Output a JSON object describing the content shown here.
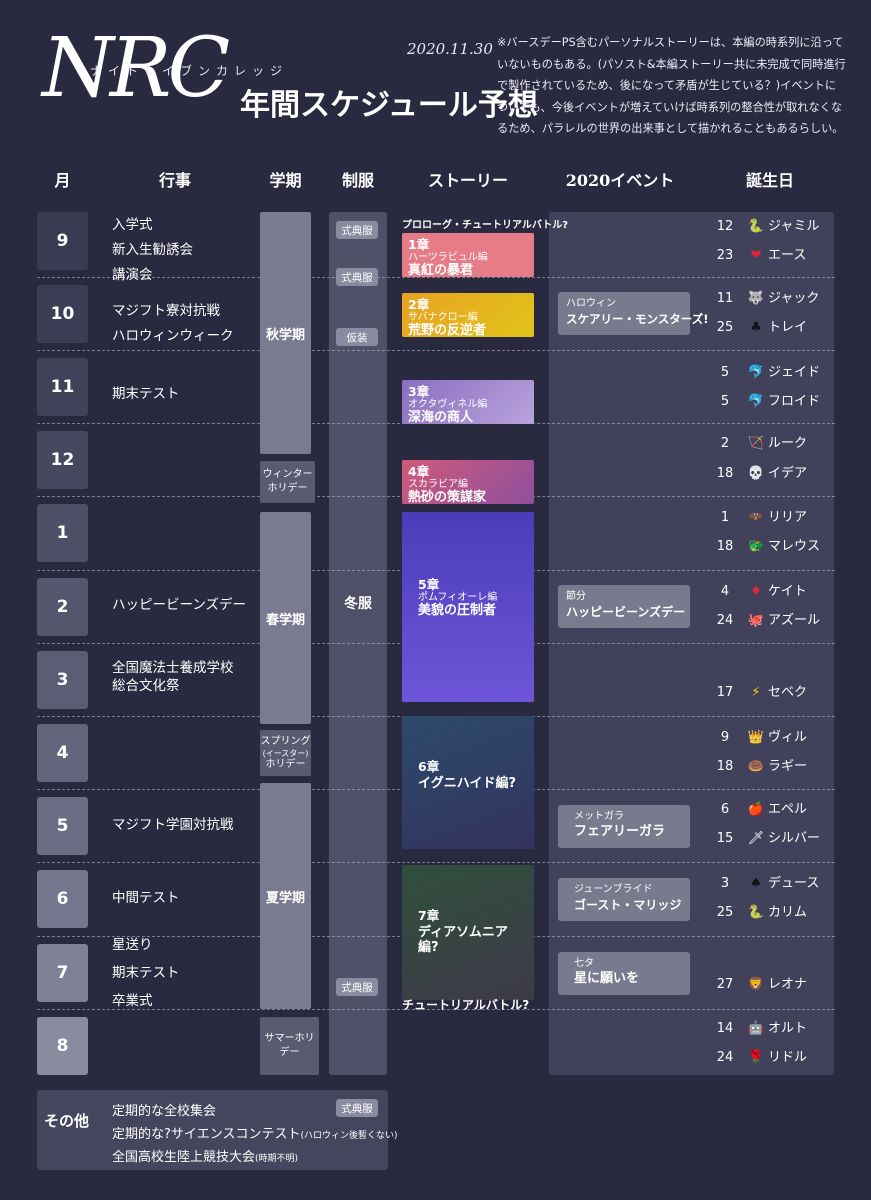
{
  "header": {
    "logo": "NRC",
    "logo_ruby": "ナイトレイブンカレッジ",
    "date": "2020.11.30",
    "title": "年間スケジュール予想",
    "note": "※バースデーPS含むパーソナルストーリーは、本編の時系列に沿っていないものもある。(パソスト&本編ストーリー共に未完成で同時進行で製作されているため、後になって矛盾が生じている？)イベントについても、今後イベントが増えていけば時系列の整合性が取れなくなるため、パラレルの世界の出来事として描かれることもあるらしい。"
  },
  "columns": {
    "month": "月",
    "events": "行事",
    "term": "学期",
    "uniform": "制服",
    "story": "ストーリー",
    "event2020": "2020イベント",
    "birthday": "誕生日"
  },
  "months": [
    "9",
    "10",
    "11",
    "12",
    "1",
    "2",
    "3",
    "4",
    "5",
    "6",
    "7",
    "8"
  ],
  "school_events": {
    "m9_1": "入学式",
    "m9_2": "新入生勧誘会",
    "m9_3": "講演会",
    "m10_1": "マジフト寮対抗戦",
    "m10_2": "ハロウィンウィーク",
    "m11_1": "期末テスト",
    "m2_1": "ハッピービーンズデー",
    "m3_1": "全国魔法士養成学校",
    "m3_2": "総合文化祭",
    "m5_1": "マジフト学園対抗戦",
    "m6_1": "中間テスト",
    "m7_1": "星送り",
    "m7_2": "期末テスト",
    "m7_3": "卒業式"
  },
  "terms": {
    "autumn": "秋学期",
    "winter": "ウィンターホリデー",
    "spring_term": "春学期",
    "spring_holiday_1": "スプリング",
    "spring_holiday_2": "(イースター)",
    "spring_holiday_3": "ホリデー",
    "summer_term": "夏学期",
    "summer_holiday": "サマーホリデー"
  },
  "uniform": {
    "ceremony": "式典服",
    "costume": "仮装",
    "winter": "冬服"
  },
  "story": {
    "prologue": "プロローグ・チュートリアルバトル?",
    "ch1": {
      "num": "1章",
      "arc": "ハーツラビュル編",
      "sub": "真紅の暴君",
      "color": "#e57c87"
    },
    "ch2": {
      "num": "2章",
      "arc": "サバナクロー編",
      "sub": "荒野の反逆者",
      "color": "#e6b31a"
    },
    "ch3": {
      "num": "3章",
      "arc": "オクタヴィネル編",
      "sub": "深海の商人",
      "color": "#a58fcf"
    },
    "ch4": {
      "num": "4章",
      "arc": "スカラビア編",
      "sub": "熱砂の策謀家",
      "color": "#b0588e"
    },
    "ch5": {
      "num": "5章",
      "arc": "ポムフィオーレ編",
      "sub": "美貌の圧制者",
      "color": "#5a48c9"
    },
    "ch6": {
      "num": "6章",
      "arc": "",
      "sub": "イグニハイド編?",
      "color": "#2d3e6e"
    },
    "ch7": {
      "num": "7章",
      "arc": "",
      "sub": "ディアソムニア編?",
      "color": "#3a4a3e"
    },
    "tutorial": "チュートリアルバトル?"
  },
  "events2020": {
    "halloween": {
      "l1": "ハロウィン",
      "l2": "スケアリー・モンスターズ!"
    },
    "setsubun": {
      "l1": "節分",
      "l2": "ハッピービーンズデー"
    },
    "metgala": {
      "l1": "メットガラ",
      "l2": "フェアリーガラ"
    },
    "june": {
      "l1": "ジューンブライド",
      "l2": "ゴースト・マリッジ"
    },
    "tanabata": {
      "l1": "七タ",
      "l2": "星に願いを"
    }
  },
  "birthdays": [
    {
      "day": "12",
      "icon": "🐍",
      "name": "ジャミル"
    },
    {
      "day": "23",
      "icon": "❤",
      "name": "エース"
    },
    {
      "day": "11",
      "icon": "🐺",
      "name": "ジャック"
    },
    {
      "day": "25",
      "icon": "♣",
      "name": "トレイ"
    },
    {
      "day": "5",
      "icon": "🐬",
      "name": "ジェイド"
    },
    {
      "day": "5",
      "icon": "🐬",
      "name": "フロイド"
    },
    {
      "day": "2",
      "icon": "🏹",
      "name": "ルーク"
    },
    {
      "day": "18",
      "icon": "💀",
      "name": "イデア"
    },
    {
      "day": "1",
      "icon": "🦇",
      "name": "リリア"
    },
    {
      "day": "18",
      "icon": "🐲",
      "name": "マレウス"
    },
    {
      "day": "4",
      "icon": "♦",
      "name": "ケイト"
    },
    {
      "day": "24",
      "icon": "🐙",
      "name": "アズール"
    },
    {
      "day": "17",
      "icon": "⚡",
      "name": "セベク"
    },
    {
      "day": "9",
      "icon": "👑",
      "name": "ヴィル"
    },
    {
      "day": "18",
      "icon": "🍩",
      "name": "ラギー"
    },
    {
      "day": "6",
      "icon": "🍎",
      "name": "エペル"
    },
    {
      "day": "15",
      "icon": "🗡",
      "name": "シルバー"
    },
    {
      "day": "3",
      "icon": "♠",
      "name": "デュース"
    },
    {
      "day": "25",
      "icon": "🐍",
      "name": "カリム"
    },
    {
      "day": "27",
      "icon": "🦁",
      "name": "レオナ"
    },
    {
      "day": "14",
      "icon": "🤖",
      "name": "オルト"
    },
    {
      "day": "24",
      "icon": "🌹",
      "name": "リドル"
    }
  ],
  "other": {
    "label": "その他",
    "item1": "定期的な全校集会",
    "item2": "定期的な?サイエンスコンテスト",
    "item2_note": "(ハロウィン後暫くない)",
    "item3": "全国高校生陸上競技大会",
    "item3_note": "(時期不明)",
    "badge": "式典服"
  }
}
